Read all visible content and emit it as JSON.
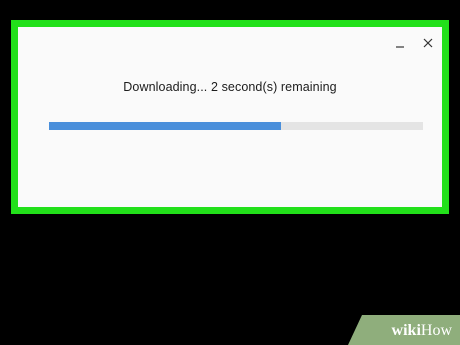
{
  "dialog": {
    "status_text": "Downloading... 2 second(s) remaining",
    "progress_fraction": 0.62
  },
  "window_controls": {
    "minimize_icon": "minimize-icon",
    "close_icon": "close-icon"
  },
  "colors": {
    "highlight": "#22e01a",
    "progress_fill": "#4a8fdb",
    "progress_track": "#e4e4e4",
    "dialog_background": "#fafafa"
  },
  "watermark": {
    "brand_prefix": "wiki",
    "brand_suffix": "How"
  }
}
